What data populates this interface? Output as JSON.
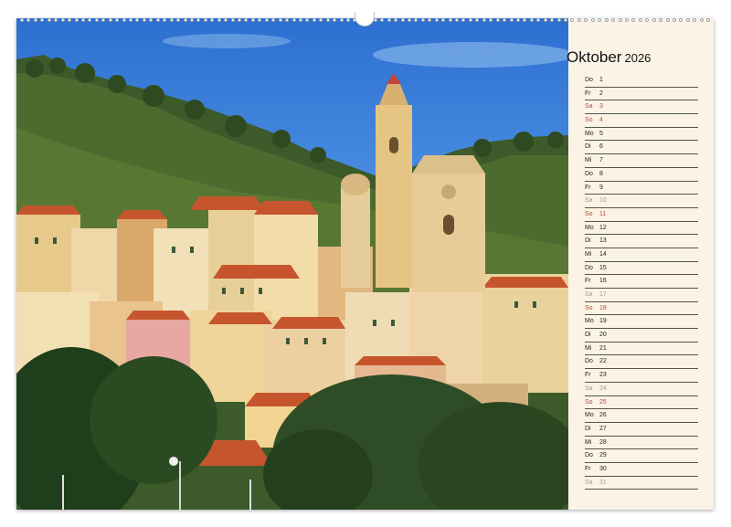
{
  "calendar": {
    "month": "Oktober",
    "year": "2026",
    "days": [
      {
        "wd": "Do",
        "d": "1",
        "type": "weekday"
      },
      {
        "wd": "Fr",
        "d": "2",
        "type": "weekday"
      },
      {
        "wd": "Sa",
        "d": "3",
        "type": "sun"
      },
      {
        "wd": "So",
        "d": "4",
        "type": "sun"
      },
      {
        "wd": "Mo",
        "d": "5",
        "type": "weekday"
      },
      {
        "wd": "Di",
        "d": "6",
        "type": "weekday"
      },
      {
        "wd": "Mi",
        "d": "7",
        "type": "weekday"
      },
      {
        "wd": "Do",
        "d": "8",
        "type": "weekday"
      },
      {
        "wd": "Fr",
        "d": "9",
        "type": "weekday"
      },
      {
        "wd": "Sa",
        "d": "10",
        "type": "sat"
      },
      {
        "wd": "So",
        "d": "11",
        "type": "sun"
      },
      {
        "wd": "Mo",
        "d": "12",
        "type": "weekday"
      },
      {
        "wd": "Di",
        "d": "13",
        "type": "weekday"
      },
      {
        "wd": "Mi",
        "d": "14",
        "type": "weekday"
      },
      {
        "wd": "Do",
        "d": "15",
        "type": "weekday"
      },
      {
        "wd": "Fr",
        "d": "16",
        "type": "weekday"
      },
      {
        "wd": "Sa",
        "d": "17",
        "type": "sat"
      },
      {
        "wd": "So",
        "d": "18",
        "type": "sun"
      },
      {
        "wd": "Mo",
        "d": "19",
        "type": "weekday"
      },
      {
        "wd": "Di",
        "d": "20",
        "type": "weekday"
      },
      {
        "wd": "Mi",
        "d": "21",
        "type": "weekday"
      },
      {
        "wd": "Do",
        "d": "22",
        "type": "weekday"
      },
      {
        "wd": "Fr",
        "d": "23",
        "type": "weekday"
      },
      {
        "wd": "Sa",
        "d": "24",
        "type": "sat"
      },
      {
        "wd": "So",
        "d": "25",
        "type": "sun"
      },
      {
        "wd": "Mo",
        "d": "26",
        "type": "weekday"
      },
      {
        "wd": "Di",
        "d": "27",
        "type": "weekday"
      },
      {
        "wd": "Mi",
        "d": "28",
        "type": "weekday"
      },
      {
        "wd": "Do",
        "d": "29",
        "type": "weekday"
      },
      {
        "wd": "Fr",
        "d": "30",
        "type": "weekday"
      },
      {
        "wd": "Sa",
        "d": "31",
        "type": "sat"
      }
    ]
  },
  "colors": {
    "sunday": "#c0453a",
    "saturday": "#b09a86",
    "panel": "#fbf4e6"
  }
}
